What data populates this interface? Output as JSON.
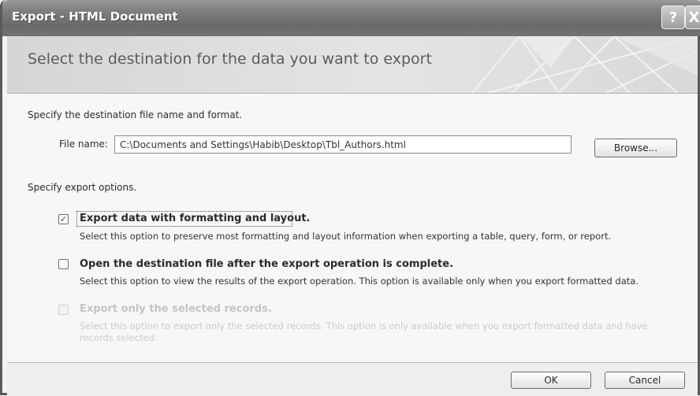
{
  "window": {
    "title": "Export - HTML Document",
    "help_glyph": "?",
    "close_glyph": "X"
  },
  "header": {
    "text": "Select the destination for the data you want to export"
  },
  "destination": {
    "heading": "Specify the destination file name and format.",
    "file_name_label": "File name:",
    "file_name_value": "C:\\Documents and Settings\\Habib\\Desktop\\Tbl_Authors.html",
    "browse_label": "Browse..."
  },
  "options": {
    "heading": "Specify export options.",
    "items": [
      {
        "title": "Export data with formatting and layout.",
        "description": "Select this option to preserve most formatting and layout information when exporting a table, query, form, or report.",
        "checked": true,
        "enabled": true
      },
      {
        "title": "Open the destination file after the export operation is complete.",
        "description": "Select this option to view the results of the export operation. This option is available only when you export formatted data.",
        "checked": false,
        "enabled": true
      },
      {
        "title": "Export only the selected records.",
        "description": "Select this option to export only the selected records. This option is only available when you export formatted data and have records selected.",
        "checked": false,
        "enabled": false
      }
    ]
  },
  "footer": {
    "ok_label": "OK",
    "cancel_label": "Cancel"
  },
  "colors": {
    "title_bar": "#7a7a7a",
    "dialog_background": "#f7f7f7",
    "disabled_text": "#c4c4c4"
  },
  "icons": {
    "checkmark": "✓"
  }
}
